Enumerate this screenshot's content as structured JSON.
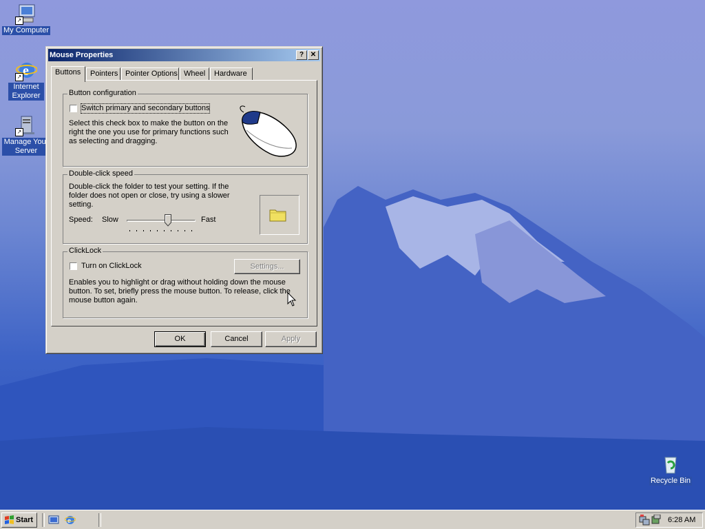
{
  "desktop": {
    "icons": [
      {
        "label": "My Computer",
        "icon": "my-computer-icon"
      },
      {
        "label": "Internet Explorer",
        "icon": "internet-explorer-icon"
      },
      {
        "label": "Manage Your Server",
        "icon": "manage-server-icon"
      },
      {
        "label": "Recycle Bin",
        "icon": "recycle-bin-icon"
      }
    ]
  },
  "dialog": {
    "title": "Mouse Properties",
    "help_glyph": "?",
    "close_glyph": "✕",
    "tabs": [
      "Buttons",
      "Pointers",
      "Pointer Options",
      "Wheel",
      "Hardware"
    ],
    "active_tab": "Buttons",
    "button_config": {
      "title": "Button configuration",
      "checkbox_label": "Switch primary and secondary buttons",
      "checked": false,
      "description": [
        "Select this check box to make the button on the",
        "right the one you use for primary functions such",
        "as selecting and dragging."
      ]
    },
    "double_click": {
      "title": "Double-click speed",
      "description": [
        "Double-click the folder to test your setting. If the",
        "folder does not open or close, try using a slower",
        "setting."
      ],
      "speed_label": "Speed:",
      "slow_label": "Slow",
      "fast_label": "Fast",
      "slider_value": 0.6
    },
    "clicklock": {
      "title": "ClickLock",
      "checkbox_label": "Turn on ClickLock",
      "checked": false,
      "settings_button": "Settings...",
      "description": [
        "Enables you to highlight or drag without holding down the mouse",
        "button. To set, briefly press the mouse button. To release, click the",
        "mouse button again."
      ]
    },
    "buttons": {
      "ok": "OK",
      "cancel": "Cancel",
      "apply": "Apply"
    }
  },
  "taskbar": {
    "start_label": "Start",
    "clock": "6:28 AM"
  },
  "colors": {
    "title_start": "#0a246a",
    "title_end": "#a6caf0",
    "face": "#d4d0c8"
  }
}
